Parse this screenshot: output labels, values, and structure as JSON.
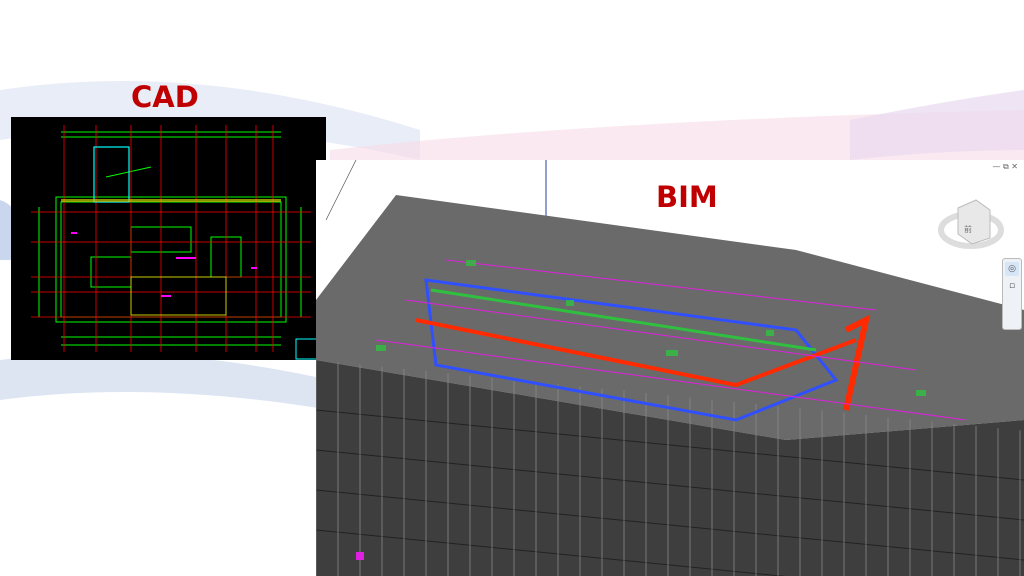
{
  "slide": {
    "cad_label": "CAD",
    "bim_label": "BIM"
  },
  "viewer": {
    "window_controls": [
      "—",
      "⧉",
      "✕"
    ],
    "viewcube_face": "前"
  },
  "colors": {
    "label": "#c00000",
    "cad_background": "#000000",
    "cad_grid": "#00ff00",
    "cad_axis": "#ff0000",
    "pipe_red": "#ff2a00",
    "pipe_blue": "#3050ff",
    "pipe_green": "#30c040",
    "pipe_magenta": "#e020e0",
    "building": "#4a4a4a"
  }
}
